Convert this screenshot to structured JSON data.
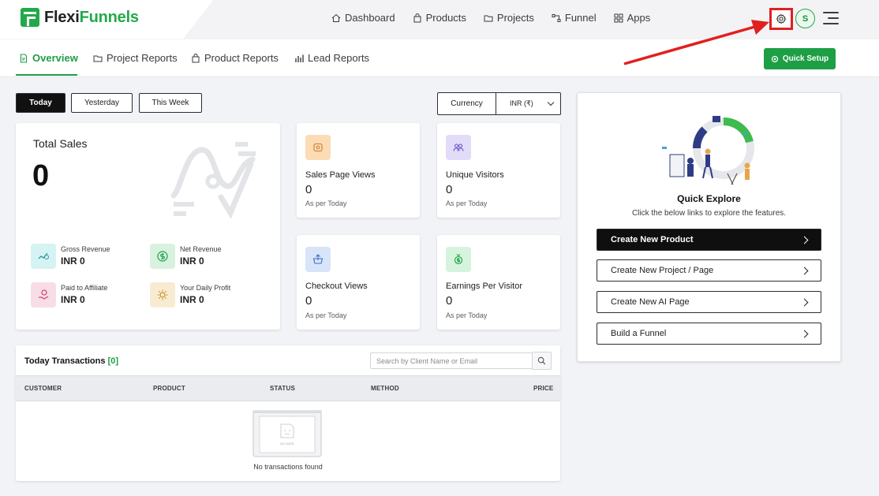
{
  "brand": {
    "name_part1": "Flexi",
    "name_part2": "Funnels",
    "accent": "#23a94b",
    "alert": "#e0201f"
  },
  "mainnav": [
    {
      "label": "Dashboard",
      "icon": "home-icon"
    },
    {
      "label": "Products",
      "icon": "bag-icon"
    },
    {
      "label": "Projects",
      "icon": "folder-icon"
    },
    {
      "label": "Funnel",
      "icon": "funnel-icon"
    },
    {
      "label": "Apps",
      "icon": "grid-icon"
    }
  ],
  "user": {
    "initial": "S"
  },
  "subnav": [
    {
      "label": "Overview",
      "icon": "document-icon",
      "active": true
    },
    {
      "label": "Project Reports",
      "icon": "folder-icon"
    },
    {
      "label": "Product Reports",
      "icon": "bag-icon"
    },
    {
      "label": "Lead Reports",
      "icon": "bar-chart-icon"
    }
  ],
  "quick_setup_label": "Quick Setup",
  "filters": {
    "today": "Today",
    "yesterday": "Yesterday",
    "this_week": "This Week"
  },
  "currency": {
    "label": "Currency",
    "selected": "INR (₹)"
  },
  "total_sales": {
    "title": "Total Sales",
    "value": "0",
    "metrics": [
      {
        "label": "Gross Revenue",
        "currency": "INR",
        "value": "0",
        "icon": "revenue-icon",
        "color": "#d6f3f3"
      },
      {
        "label": "Net Revenue",
        "currency": "INR",
        "value": "0",
        "icon": "dollar-coin-icon",
        "color": "#d9f2e0"
      },
      {
        "label": "Paid to Affiliate",
        "currency": "INR",
        "value": "0",
        "icon": "hand-coin-icon",
        "color": "#f8dde6"
      },
      {
        "label": "Your Daily Profit",
        "currency": "INR",
        "value": "0",
        "icon": "sun-icon",
        "color": "#f7ecd2"
      }
    ]
  },
  "stats": [
    {
      "label": "Sales Page Views",
      "value": "0",
      "sub": "As per Today",
      "icon": "eye-icon",
      "color": "#fbdcb5"
    },
    {
      "label": "Unique Visitors",
      "value": "0",
      "sub": "As per Today",
      "icon": "users-icon",
      "color": "#e3dcf8"
    },
    {
      "label": "Checkout Views",
      "value": "0",
      "sub": "As per Today",
      "icon": "basket-icon",
      "color": "#d8e4f8"
    },
    {
      "label": "Earnings Per Visitor",
      "value": "0",
      "sub": "As per Today",
      "icon": "money-icon",
      "color": "#d6f3dd"
    }
  ],
  "quick_explore": {
    "title": "Quick Explore",
    "subtitle": "Click the below links to explore the features.",
    "buttons": [
      "Create New Product",
      "Create New Project / Page",
      "Create New AI Page",
      "Build a Funnel"
    ]
  },
  "transactions": {
    "title": "Today Transactions",
    "count": "[0]",
    "search_placeholder": "Search by Client Name or Email",
    "columns": [
      "CUSTOMER",
      "PRODUCT",
      "STATUS",
      "METHOD",
      "PRICE"
    ],
    "nodata_badge": "NO DATA",
    "empty_text": "No transactions found"
  }
}
